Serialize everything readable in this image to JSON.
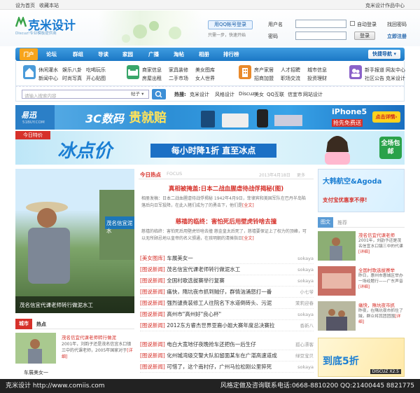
{
  "topbar": {
    "home": "设为首页",
    "fav": "收藏本站",
    "right": "克米设计作品中心"
  },
  "header": {
    "logo_text": "克米设计",
    "logo_sub": "Discuz!专业模板提供商",
    "qq_login": "用QQ帐号登录",
    "qq_hint": "只需一步，快速开始",
    "username_label": "用户名",
    "password_label": "密码",
    "auto_login": "自动登录",
    "login_btn": "登录",
    "find_pwd": "找回密码",
    "register": "立即注册",
    "user_select": "用户名"
  },
  "nav": {
    "items": [
      "门户",
      "论坛",
      "群组",
      "导读",
      "家园",
      "广播",
      "淘帖",
      "相册",
      "排行榜"
    ],
    "quick": "快捷导航"
  },
  "categories": [
    {
      "icon": "house-icon",
      "color": "#4a9bd9",
      "lines": [
        "休闲灌水",
        "新闻中心"
      ],
      "lines2": [
        "娱乐八卦",
        "时尚写真"
      ],
      "lines3": [
        "吃喝玩乐",
        "开心贴图"
      ]
    },
    {
      "icon": "couch-icon",
      "color": "#39a66a",
      "lines": [
        "商家信息",
        "房屋出租"
      ],
      "lines2": [
        "家具装修",
        "二手市场"
      ],
      "lines3": [
        "美女图库",
        "女人世界"
      ]
    },
    {
      "icon": "building-icon",
      "color": "#e98a2b",
      "lines": [
        "房产家居",
        "招商加盟"
      ],
      "lines2": [
        "人才招聘",
        "职场交流"
      ],
      "lines3": [
        "城市信息",
        "投资理财"
      ]
    },
    {
      "icon": "people-icon",
      "color": "#8b62c9",
      "lines": [
        "新手报道",
        "社区公告"
      ],
      "lines2": [
        "网友中心",
        "克米设计"
      ],
      "lines3": []
    }
  ],
  "search": {
    "placeholder": "请输入搜索内容",
    "scope": "帖子",
    "hot_label": "热搜:",
    "hot": [
      "克米设计",
      "风格设计",
      "Discuz",
      "美女",
      "QQ互联",
      "信宜市",
      "网站设计"
    ]
  },
  "banner1": {
    "brand": "易迅",
    "sub": "51BUY.COM",
    "title": "3C数码",
    "bold": "贵就赔",
    "phone": "iPhone5",
    "free": "抢先免费送",
    "cta": "点击详情"
  },
  "banner2": {
    "tag": "今日特价",
    "big": "冰点价",
    "slogan": "每小时降1折 直至冰点",
    "badge": "全场包邮"
  },
  "photo": {
    "caption": "茂名信宜代课老师转行做泥水工",
    "overlay": "茂名信宜泥水"
  },
  "today": {
    "tab1": "今日热点",
    "tab2": "FOCUS",
    "date": "2013年4月18日",
    "more": "更多",
    "h1": "真相被掩盖:日本二战血腥虐待战俘揭秘(图)",
    "p1": "相册发稿：日本二战血腥虐待战俘揭秘 1942年4月9日，菲律宾和美国军队在巴丹半岛陷落后向日军投降，在此入猪们成为了的勇击下，他们是",
    "p1more": "[全文]",
    "h2": "慈禧的临终：害怕死后用壁虎铃啥去撞",
    "p2": "慈禧的临终：害怕死后用壁虎铃啥去撞 慈金皇太后死了，慈禧要保证上了权力的顶峰，可以无所顾忌地以皇帝的名义颁通，在孩明朝的清摊指日",
    "p2more": "[全文]"
  },
  "news1": [
    {
      "cat": "[美女图库]",
      "t": "车展美女一",
      "a": "sokaya"
    },
    {
      "cat": "[图说新闻]",
      "t": "茂名信宜代课老师转行做泥水工",
      "a": "sokaya"
    },
    {
      "cat": "[图说新闻]",
      "t": "全国村歌选拔赛举行复赛",
      "a": "sokaya"
    },
    {
      "cat": "[图说新闻]",
      "t": "痛快，隋坑夜市抓到贼仔，群情汹涌怒打一番",
      "a": "小七爷"
    },
    {
      "cat": "[图说新闻]",
      "t": "强烈谴责装修工人往院名下水道倒砖头、污泥",
      "a": "茉莉迎春"
    },
    {
      "cat": "[图说新闻]",
      "t": "高州市\"高州好\"良心杯\"",
      "a": "sokaya"
    },
    {
      "cat": "[图说新闻]",
      "t": "2012东方睿杰世界亚裔小姐大赛年度总决赛拉",
      "a": "香新八"
    }
  ],
  "news2": [
    {
      "cat": "[图说新闻]",
      "t": "电白大宽地仔夜晚抢车还把伤一后生仔",
      "a": "孤心漂客"
    },
    {
      "cat": "[图说新闻]",
      "t": "化州城湾级交警大队扣留面某车在广湛高速道成",
      "a": "绿豆宝贝"
    },
    {
      "cat": "[图说新闻]",
      "t": "可惜了，这个南村仔，广州马拉松刚公里猝死",
      "a": "sokaya"
    }
  ],
  "city": {
    "tab": "城市",
    "hot": "热点",
    "title": "茂名信宜代课老师转行做泥",
    "text": "2001年，刘韵子还是茂名信宜水口镇三中的代课老师，2005年国家对于",
    "more": "[详细]",
    "foot": "车展美女一"
  },
  "side": {
    "ad1_title": "大韩航空&Agoda",
    "ad1_sub": "支付宝优惠享不停!",
    "pic_tab": "图文",
    "pic_tab2": "推荐",
    "items": [
      {
        "title": "茂名信宜代课老师",
        "text": "2001年，刘韵予还是茂名信宜水口镇三中的代课",
        "more": "[详细]"
      },
      {
        "title": "全国村歌选拔赛举",
        "text": "昨日，惠州市惠城区举办一场经题行——广东声音",
        "more": "[详细]"
      },
      {
        "title": "痛快，隋坑夜市抓",
        "text": "昨夜，在隋坑夜市抓住了贼，群众将其团团围",
        "more": "[详细]"
      }
    ],
    "ad2_main": "到底5折",
    "ad2_brand": "DISCUZ X2.5"
  },
  "footer": {
    "left": "克米设计 http://www.comiis.com",
    "right": "风格定做及咨询联系电话:0668-8810200  QQ:21400445 8821775"
  }
}
